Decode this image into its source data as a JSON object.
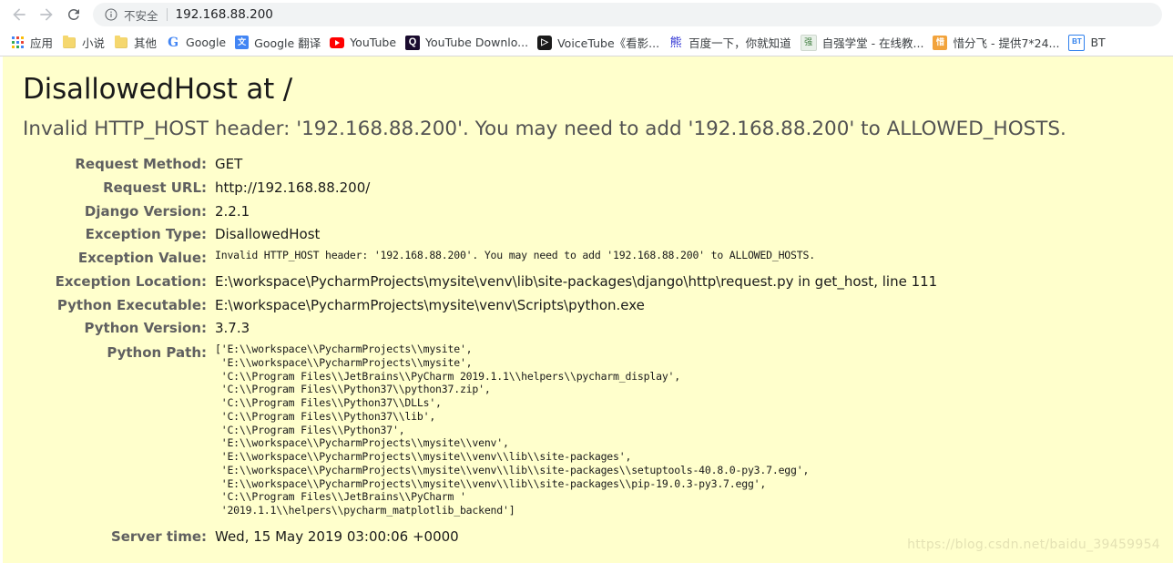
{
  "browser": {
    "back_icon": "back-arrow-icon",
    "forward_icon": "forward-arrow-icon",
    "reload_icon": "reload-icon",
    "omnibox": {
      "info_icon": "info-circle-icon",
      "security_label": "不安全",
      "url": "192.168.88.200"
    },
    "bookmarks": [
      {
        "label": "应用",
        "icon": "apps-grid-icon"
      },
      {
        "label": "小说",
        "icon": "folder-icon"
      },
      {
        "label": "其他",
        "icon": "folder-icon"
      },
      {
        "label": "Google",
        "icon": "google-icon",
        "glyph": "G"
      },
      {
        "label": "Google 翻译",
        "icon": "google-translate-icon",
        "glyph": "文"
      },
      {
        "label": "YouTube",
        "icon": "youtube-icon"
      },
      {
        "label": "YouTube Downlo...",
        "icon": "youtube-downloader-icon",
        "glyph": "Q"
      },
      {
        "label": "VoiceTube《看影...",
        "icon": "voicetube-icon",
        "glyph": "▷"
      },
      {
        "label": "百度一下，你就知道",
        "icon": "baidu-icon",
        "glyph": "熊"
      },
      {
        "label": "自强学堂 - 在线教...",
        "icon": "ziqiang-icon",
        "glyph": "强"
      },
      {
        "label": "惜分飞 - 提供7*24...",
        "icon": "xifenfei-icon",
        "glyph": "惜"
      },
      {
        "label": "BT",
        "icon": "bturl-icon",
        "glyph": "BT"
      }
    ]
  },
  "page": {
    "title": "DisallowedHost at /",
    "subtitle": "Invalid HTTP_HOST header: '192.168.88.200'. You may need to add '192.168.88.200' to ALLOWED_HOSTS.",
    "rows": [
      {
        "label": "Request Method:",
        "value": "GET",
        "mono": false
      },
      {
        "label": "Request URL:",
        "value": "http://192.168.88.200/",
        "mono": false
      },
      {
        "label": "Django Version:",
        "value": "2.2.1",
        "mono": false
      },
      {
        "label": "Exception Type:",
        "value": "DisallowedHost",
        "mono": false
      },
      {
        "label": "Exception Value:",
        "value": "Invalid HTTP_HOST header: '192.168.88.200'. You may need to add '192.168.88.200' to ALLOWED_HOSTS.",
        "mono": true
      },
      {
        "label": "Exception Location:",
        "value": "E:\\workspace\\PycharmProjects\\mysite\\venv\\lib\\site-packages\\django\\http\\request.py in get_host, line 111",
        "mono": false
      },
      {
        "label": "Python Executable:",
        "value": "E:\\workspace\\PycharmProjects\\mysite\\venv\\Scripts\\python.exe",
        "mono": false
      },
      {
        "label": "Python Version:",
        "value": "3.7.3",
        "mono": false
      }
    ],
    "python_path_label": "Python Path:",
    "python_path_text": "['E:\\\\workspace\\\\PycharmProjects\\\\mysite',\n 'E:\\\\workspace\\\\PycharmProjects\\\\mysite',\n 'C:\\\\Program Files\\\\JetBrains\\\\PyCharm 2019.1.1\\\\helpers\\\\pycharm_display',\n 'C:\\\\Program Files\\\\Python37\\\\python37.zip',\n 'C:\\\\Program Files\\\\Python37\\\\DLLs',\n 'C:\\\\Program Files\\\\Python37\\\\lib',\n 'C:\\\\Program Files\\\\Python37',\n 'E:\\\\workspace\\\\PycharmProjects\\\\mysite\\\\venv',\n 'E:\\\\workspace\\\\PycharmProjects\\\\mysite\\\\venv\\\\lib\\\\site-packages',\n 'E:\\\\workspace\\\\PycharmProjects\\\\mysite\\\\venv\\\\lib\\\\site-packages\\\\setuptools-40.8.0-py3.7.egg',\n 'E:\\\\workspace\\\\PycharmProjects\\\\mysite\\\\venv\\\\lib\\\\site-packages\\\\pip-19.0.3-py3.7.egg',\n 'C:\\\\Program Files\\\\JetBrains\\\\PyCharm '\n '2019.1.1\\\\helpers\\\\pycharm_matplotlib_backend']",
    "server_time_label": "Server time:",
    "server_time_value": "Wed, 15 May 2019 03:00:06 +0000",
    "watermark": "https://blog.csdn.net/baidu_39459954",
    "background_color": "#ffffcc"
  }
}
